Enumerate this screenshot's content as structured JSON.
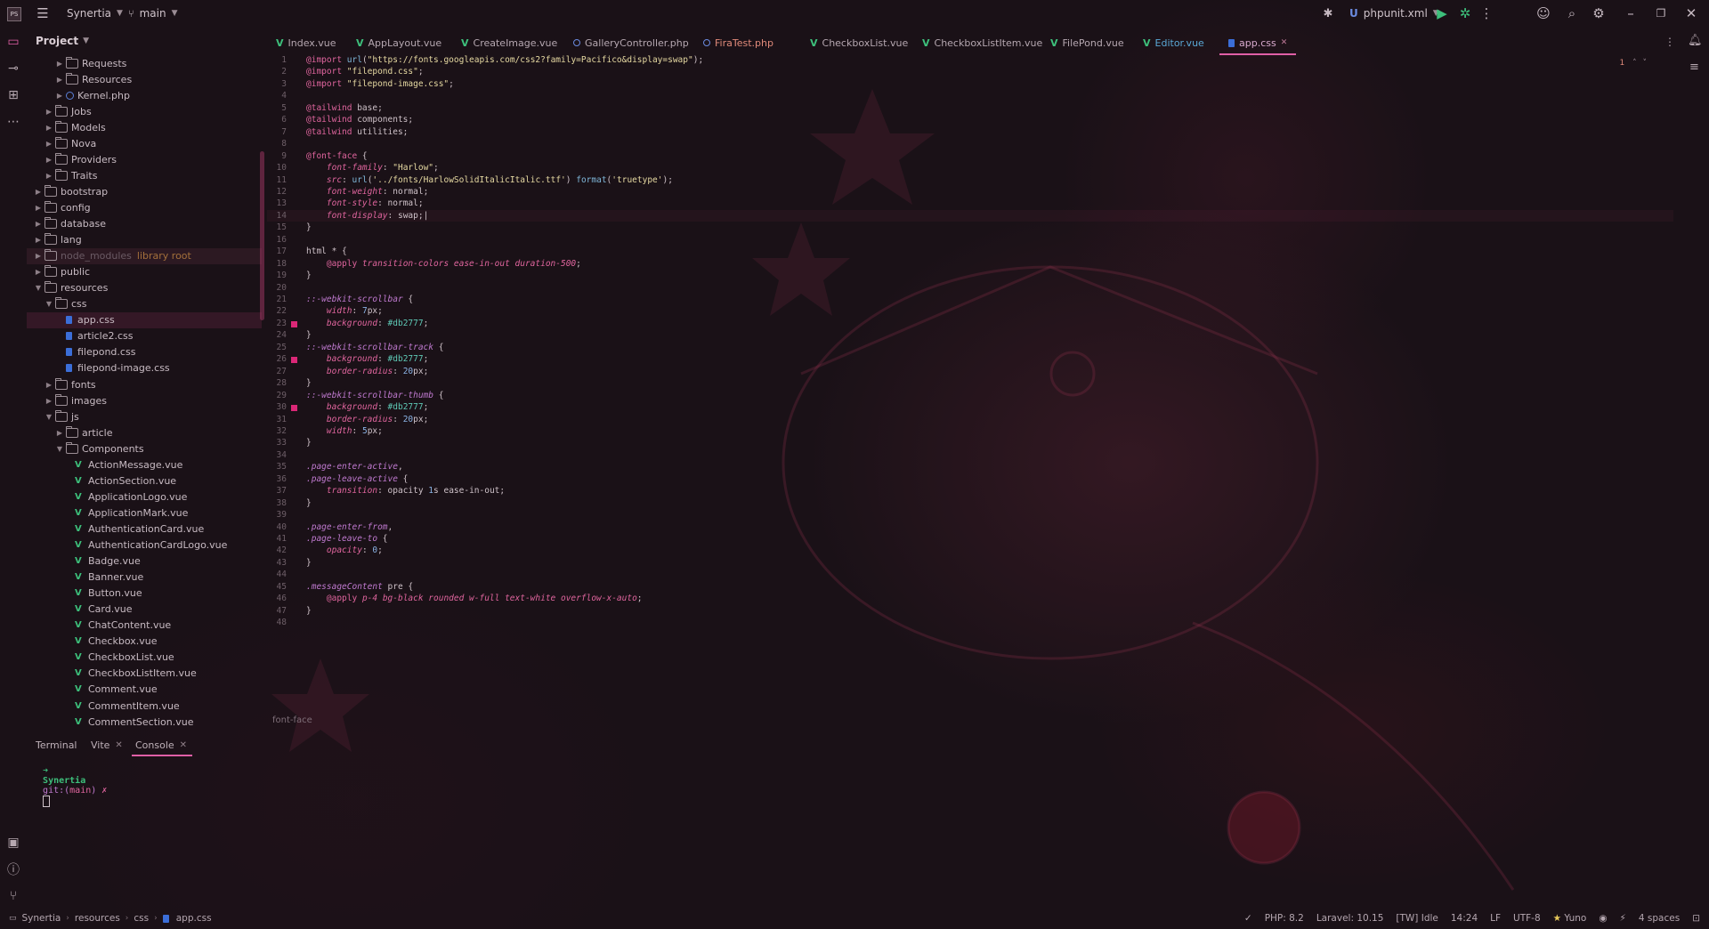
{
  "titlebar": {
    "project": "Synertia",
    "branch": "main",
    "run_config": "phpunit.xml"
  },
  "project_panel": {
    "title": "Project",
    "tree": [
      {
        "label": "Requests",
        "type": "folder",
        "depth": 3,
        "expanded": false
      },
      {
        "label": "Resources",
        "type": "folder",
        "depth": 3,
        "expanded": false
      },
      {
        "label": "Kernel.php",
        "type": "php",
        "depth": 3
      },
      {
        "label": "Jobs",
        "type": "folder",
        "depth": 2,
        "expanded": false
      },
      {
        "label": "Models",
        "type": "folder",
        "depth": 2,
        "expanded": false
      },
      {
        "label": "Nova",
        "type": "folder",
        "depth": 2,
        "expanded": false
      },
      {
        "label": "Providers",
        "type": "folder",
        "depth": 2,
        "expanded": false
      },
      {
        "label": "Traits",
        "type": "folder",
        "depth": 2,
        "expanded": false
      },
      {
        "label": "bootstrap",
        "type": "folder",
        "depth": 1,
        "expanded": false
      },
      {
        "label": "config",
        "type": "folder",
        "depth": 1,
        "expanded": false
      },
      {
        "label": "database",
        "type": "folder",
        "depth": 1,
        "expanded": false
      },
      {
        "label": "lang",
        "type": "folder",
        "depth": 1,
        "expanded": false
      },
      {
        "label": "node_modules",
        "type": "folder",
        "depth": 1,
        "expanded": false,
        "muted": true,
        "extra": "library root"
      },
      {
        "label": "public",
        "type": "folder",
        "depth": 1,
        "expanded": false
      },
      {
        "label": "resources",
        "type": "folder",
        "depth": 1,
        "expanded": true
      },
      {
        "label": "css",
        "type": "folder",
        "depth": 2,
        "expanded": true
      },
      {
        "label": "app.css",
        "type": "css",
        "depth": 3,
        "selected": true
      },
      {
        "label": "article2.css",
        "type": "css",
        "depth": 3
      },
      {
        "label": "filepond.css",
        "type": "css",
        "depth": 3
      },
      {
        "label": "filepond-image.css",
        "type": "css",
        "depth": 3
      },
      {
        "label": "fonts",
        "type": "folder",
        "depth": 2,
        "expanded": false
      },
      {
        "label": "images",
        "type": "folder",
        "depth": 2,
        "expanded": false
      },
      {
        "label": "js",
        "type": "folder",
        "depth": 2,
        "expanded": true
      },
      {
        "label": "article",
        "type": "folder",
        "depth": 3,
        "expanded": false
      },
      {
        "label": "Components",
        "type": "folder",
        "depth": 3,
        "expanded": true
      },
      {
        "label": "ActionMessage.vue",
        "type": "vue",
        "depth": 4
      },
      {
        "label": "ActionSection.vue",
        "type": "vue",
        "depth": 4
      },
      {
        "label": "ApplicationLogo.vue",
        "type": "vue",
        "depth": 4
      },
      {
        "label": "ApplicationMark.vue",
        "type": "vue",
        "depth": 4
      },
      {
        "label": "AuthenticationCard.vue",
        "type": "vue",
        "depth": 4
      },
      {
        "label": "AuthenticationCardLogo.vue",
        "type": "vue",
        "depth": 4
      },
      {
        "label": "Badge.vue",
        "type": "vue",
        "depth": 4
      },
      {
        "label": "Banner.vue",
        "type": "vue",
        "depth": 4
      },
      {
        "label": "Button.vue",
        "type": "vue",
        "depth": 4
      },
      {
        "label": "Card.vue",
        "type": "vue",
        "depth": 4
      },
      {
        "label": "ChatContent.vue",
        "type": "vue",
        "depth": 4
      },
      {
        "label": "Checkbox.vue",
        "type": "vue",
        "depth": 4
      },
      {
        "label": "CheckboxList.vue",
        "type": "vue",
        "depth": 4
      },
      {
        "label": "CheckboxListItem.vue",
        "type": "vue",
        "depth": 4
      },
      {
        "label": "Comment.vue",
        "type": "vue",
        "depth": 4
      },
      {
        "label": "CommentItem.vue",
        "type": "vue",
        "depth": 4
      },
      {
        "label": "CommentSection.vue",
        "type": "vue",
        "depth": 4
      }
    ]
  },
  "tabs": [
    {
      "label": "Index.vue",
      "type": "vue"
    },
    {
      "label": "AppLayout.vue",
      "type": "vue"
    },
    {
      "label": "CreateImage.vue",
      "type": "vue"
    },
    {
      "label": "GalleryController.php",
      "type": "php"
    },
    {
      "label": "FiraTest.php",
      "type": "php",
      "state": "warn"
    },
    {
      "label": "CheckboxList.vue",
      "type": "vue"
    },
    {
      "label": "CheckboxListItem.vue",
      "type": "vue"
    },
    {
      "label": "FilePond.vue",
      "type": "vue"
    },
    {
      "label": "Editor.vue",
      "type": "vue",
      "state": "modified"
    },
    {
      "label": "app.css",
      "type": "css",
      "active": true
    }
  ],
  "editor": {
    "problems_count": "1",
    "breadcrumb": "font-face",
    "caret_line": 14,
    "markers": [
      23,
      26,
      30
    ],
    "lines": [
      [
        {
          "c": "kw",
          "t": "@import "
        },
        {
          "c": "func",
          "t": "url"
        },
        {
          "c": "val",
          "t": "("
        },
        {
          "c": "str",
          "t": "\"https://fonts.googleapis.com/css2?family=Pacifico&display=swap\""
        },
        {
          "c": "val",
          "t": ");"
        }
      ],
      [
        {
          "c": "kw",
          "t": "@import "
        },
        {
          "c": "str",
          "t": "\"filepond.css\""
        },
        {
          "c": "val",
          "t": ";"
        }
      ],
      [
        {
          "c": "kw",
          "t": "@import "
        },
        {
          "c": "str",
          "t": "\"filepond-image.css\""
        },
        {
          "c": "val",
          "t": ";"
        }
      ],
      [],
      [
        {
          "c": "kw",
          "t": "@tailwind "
        },
        {
          "c": "val",
          "t": "base;"
        }
      ],
      [
        {
          "c": "kw",
          "t": "@tailwind "
        },
        {
          "c": "val",
          "t": "components;"
        }
      ],
      [
        {
          "c": "kw",
          "t": "@tailwind "
        },
        {
          "c": "val",
          "t": "utilities;"
        }
      ],
      [],
      [
        {
          "c": "kw",
          "t": "@font-face "
        },
        {
          "c": "val",
          "t": "{"
        }
      ],
      [
        {
          "c": "val",
          "t": "    "
        },
        {
          "c": "prop",
          "t": "font-family"
        },
        {
          "c": "val",
          "t": ": "
        },
        {
          "c": "str",
          "t": "\"Harlow\""
        },
        {
          "c": "val",
          "t": ";"
        }
      ],
      [
        {
          "c": "val",
          "t": "    "
        },
        {
          "c": "prop",
          "t": "src"
        },
        {
          "c": "val",
          "t": ": "
        },
        {
          "c": "func",
          "t": "url"
        },
        {
          "c": "val",
          "t": "("
        },
        {
          "c": "str",
          "t": "'../fonts/HarlowSolidItalicItalic.ttf'"
        },
        {
          "c": "val",
          "t": ") "
        },
        {
          "c": "func",
          "t": "format"
        },
        {
          "c": "val",
          "t": "("
        },
        {
          "c": "str",
          "t": "'truetype'"
        },
        {
          "c": "val",
          "t": ");"
        }
      ],
      [
        {
          "c": "val",
          "t": "    "
        },
        {
          "c": "prop",
          "t": "font-weight"
        },
        {
          "c": "val",
          "t": ": normal;"
        }
      ],
      [
        {
          "c": "val",
          "t": "    "
        },
        {
          "c": "prop",
          "t": "font-style"
        },
        {
          "c": "val",
          "t": ": normal;"
        }
      ],
      [
        {
          "c": "val",
          "t": "    "
        },
        {
          "c": "prop",
          "t": "font-display"
        },
        {
          "c": "val",
          "t": ": swap;|"
        }
      ],
      [
        {
          "c": "val",
          "t": "}"
        }
      ],
      [],
      [
        {
          "c": "val",
          "t": "html * {"
        }
      ],
      [
        {
          "c": "val",
          "t": "    "
        },
        {
          "c": "kw",
          "t": "@apply "
        },
        {
          "c": "prop",
          "t": "transition-colors ease-in-out duration-500"
        },
        {
          "c": "val",
          "t": ";"
        }
      ],
      [
        {
          "c": "val",
          "t": "}"
        }
      ],
      [],
      [
        {
          "c": "sel-c",
          "t": "::-webkit-scrollbar"
        },
        {
          "c": "val",
          "t": " {"
        }
      ],
      [
        {
          "c": "val",
          "t": "    "
        },
        {
          "c": "prop",
          "t": "width"
        },
        {
          "c": "val",
          "t": ": "
        },
        {
          "c": "num",
          "t": "7"
        },
        {
          "c": "val",
          "t": "px;"
        }
      ],
      [
        {
          "c": "val",
          "t": "    "
        },
        {
          "c": "prop",
          "t": "background"
        },
        {
          "c": "val",
          "t": ": "
        },
        {
          "c": "hex",
          "t": "#db2777"
        },
        {
          "c": "val",
          "t": ";"
        }
      ],
      [
        {
          "c": "val",
          "t": "}"
        }
      ],
      [
        {
          "c": "sel-c",
          "t": "::-webkit-scrollbar-track"
        },
        {
          "c": "val",
          "t": " {"
        }
      ],
      [
        {
          "c": "val",
          "t": "    "
        },
        {
          "c": "prop",
          "t": "background"
        },
        {
          "c": "val",
          "t": ": "
        },
        {
          "c": "hex",
          "t": "#db2777"
        },
        {
          "c": "val",
          "t": ";"
        }
      ],
      [
        {
          "c": "val",
          "t": "    "
        },
        {
          "c": "prop",
          "t": "border-radius"
        },
        {
          "c": "val",
          "t": ": "
        },
        {
          "c": "num",
          "t": "20"
        },
        {
          "c": "val",
          "t": "px;"
        }
      ],
      [
        {
          "c": "val",
          "t": "}"
        }
      ],
      [
        {
          "c": "sel-c",
          "t": "::-webkit-scrollbar-thumb"
        },
        {
          "c": "val",
          "t": " {"
        }
      ],
      [
        {
          "c": "val",
          "t": "    "
        },
        {
          "c": "prop",
          "t": "background"
        },
        {
          "c": "val",
          "t": ": "
        },
        {
          "c": "hex",
          "t": "#db2777"
        },
        {
          "c": "val",
          "t": ";"
        }
      ],
      [
        {
          "c": "val",
          "t": "    "
        },
        {
          "c": "prop",
          "t": "border-radius"
        },
        {
          "c": "val",
          "t": ": "
        },
        {
          "c": "num",
          "t": "20"
        },
        {
          "c": "val",
          "t": "px;"
        }
      ],
      [
        {
          "c": "val",
          "t": "    "
        },
        {
          "c": "prop",
          "t": "width"
        },
        {
          "c": "val",
          "t": ": "
        },
        {
          "c": "num",
          "t": "5"
        },
        {
          "c": "val",
          "t": "px;"
        }
      ],
      [
        {
          "c": "val",
          "t": "}"
        }
      ],
      [],
      [
        {
          "c": "sel-c",
          "t": ".page-enter-active"
        },
        {
          "c": "val",
          "t": ","
        }
      ],
      [
        {
          "c": "sel-c",
          "t": ".page-leave-active"
        },
        {
          "c": "val",
          "t": " {"
        }
      ],
      [
        {
          "c": "val",
          "t": "    "
        },
        {
          "c": "prop",
          "t": "transition"
        },
        {
          "c": "val",
          "t": ": opacity "
        },
        {
          "c": "num",
          "t": "1"
        },
        {
          "c": "val",
          "t": "s ease-in-out;"
        }
      ],
      [
        {
          "c": "val",
          "t": "}"
        }
      ],
      [],
      [
        {
          "c": "sel-c",
          "t": ".page-enter-from"
        },
        {
          "c": "val",
          "t": ","
        }
      ],
      [
        {
          "c": "sel-c",
          "t": ".page-leave-to"
        },
        {
          "c": "val",
          "t": " {"
        }
      ],
      [
        {
          "c": "val",
          "t": "    "
        },
        {
          "c": "prop",
          "t": "opacity"
        },
        {
          "c": "val",
          "t": ": "
        },
        {
          "c": "num",
          "t": "0"
        },
        {
          "c": "val",
          "t": ";"
        }
      ],
      [
        {
          "c": "val",
          "t": "}"
        }
      ],
      [],
      [
        {
          "c": "sel-c",
          "t": ".messageContent"
        },
        {
          "c": "val",
          "t": " pre {"
        }
      ],
      [
        {
          "c": "val",
          "t": "    "
        },
        {
          "c": "kw",
          "t": "@apply "
        },
        {
          "c": "prop",
          "t": "p-4 bg-black rounded w-full text-white overflow-x-auto"
        },
        {
          "c": "val",
          "t": ";"
        }
      ],
      [
        {
          "c": "val",
          "t": "}"
        }
      ],
      []
    ]
  },
  "terminal": {
    "tabs": [
      {
        "label": "Terminal",
        "closable": false,
        "active": false
      },
      {
        "label": "Vite",
        "closable": true,
        "active": false
      },
      {
        "label": "Console",
        "closable": true,
        "active": true
      }
    ],
    "prompt_arrow": "➜",
    "prompt_project": "Synertia",
    "prompt_git": "git:(",
    "prompt_branch": "main",
    "prompt_git_close": ")",
    "prompt_suffix": " ✗"
  },
  "statusbar": {
    "breadcrumb": [
      "Synertia",
      "resources",
      "css",
      "app.css"
    ],
    "php": "PHP: 8.2",
    "laravel": "Laravel: 10.15",
    "tw": "[TW] Idle",
    "position": "14:24",
    "line_sep": "LF",
    "encoding": "UTF-8",
    "theme": "Yuno",
    "indent": "4 spaces"
  },
  "colors": {
    "accent": "#e05fa6",
    "scrollbar_color": "#db2777",
    "vue_green": "#3dbf7b"
  }
}
